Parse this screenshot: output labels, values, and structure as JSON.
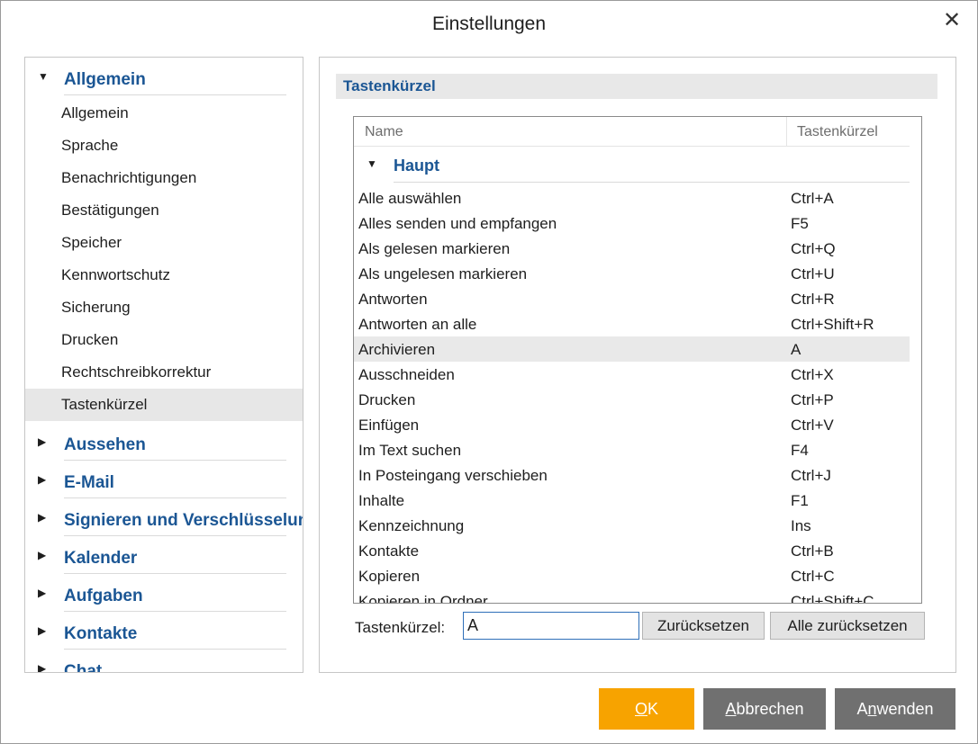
{
  "dialog": {
    "title": "Einstellungen"
  },
  "tree": {
    "groups": [
      {
        "label": "Allgemein",
        "expanded": true,
        "items": [
          "Allgemein",
          "Sprache",
          "Benachrichtigungen",
          "Bestätigungen",
          "Speicher",
          "Kennwortschutz",
          "Sicherung",
          "Drucken",
          "Rechtschreibkorrektur",
          "Tastenkürzel"
        ],
        "selected_item": "Tastenkürzel"
      },
      {
        "label": "Aussehen",
        "expanded": false
      },
      {
        "label": "E-Mail",
        "expanded": false
      },
      {
        "label": "Signieren und Verschlüsselung",
        "expanded": false
      },
      {
        "label": "Kalender",
        "expanded": false
      },
      {
        "label": "Aufgaben",
        "expanded": false
      },
      {
        "label": "Kontakte",
        "expanded": false
      },
      {
        "label": "Chat",
        "expanded": false
      }
    ]
  },
  "panel": {
    "section_title": "Tastenkürzel",
    "columns": {
      "name": "Name",
      "shortcut": "Tastenkürzel"
    },
    "group": "Haupt",
    "rows": [
      {
        "name": "Alle auswählen",
        "shortcut": "Ctrl+A"
      },
      {
        "name": "Alles senden und empfangen",
        "shortcut": "F5"
      },
      {
        "name": "Als gelesen markieren",
        "shortcut": "Ctrl+Q"
      },
      {
        "name": "Als ungelesen markieren",
        "shortcut": "Ctrl+U"
      },
      {
        "name": "Antworten",
        "shortcut": "Ctrl+R"
      },
      {
        "name": "Antworten an alle",
        "shortcut": "Ctrl+Shift+R"
      },
      {
        "name": "Archivieren",
        "shortcut": "A",
        "selected": true
      },
      {
        "name": "Ausschneiden",
        "shortcut": "Ctrl+X"
      },
      {
        "name": "Drucken",
        "shortcut": "Ctrl+P"
      },
      {
        "name": "Einfügen",
        "shortcut": "Ctrl+V"
      },
      {
        "name": "Im Text suchen",
        "shortcut": "F4"
      },
      {
        "name": "In Posteingang verschieben",
        "shortcut": "Ctrl+J"
      },
      {
        "name": "Inhalte",
        "shortcut": "F1"
      },
      {
        "name": "Kennzeichnung",
        "shortcut": "Ins"
      },
      {
        "name": "Kontakte",
        "shortcut": "Ctrl+B"
      },
      {
        "name": "Kopieren",
        "shortcut": "Ctrl+C"
      },
      {
        "name": "Kopieren in Ordner",
        "shortcut": "Ctrl+Shift+C"
      }
    ],
    "shortcut_label": "Tastenkürzel:",
    "shortcut_value": "A",
    "reset_label": "Zurücksetzen",
    "reset_all_label": "Alle zurücksetzen"
  },
  "footer": {
    "ok": {
      "label": "OK",
      "accel": "O",
      "rest": "K"
    },
    "cancel": {
      "label": "Abbrechen",
      "accel": "A",
      "rest": "bbrechen"
    },
    "apply": {
      "label": "Anwenden",
      "pre": "A",
      "accel": "n",
      "rest": "wenden"
    }
  },
  "colors": {
    "accent_blue": "#1b5694",
    "ok_orange": "#f7a300",
    "button_gray": "#707070",
    "selection": "#e7e7e7"
  }
}
